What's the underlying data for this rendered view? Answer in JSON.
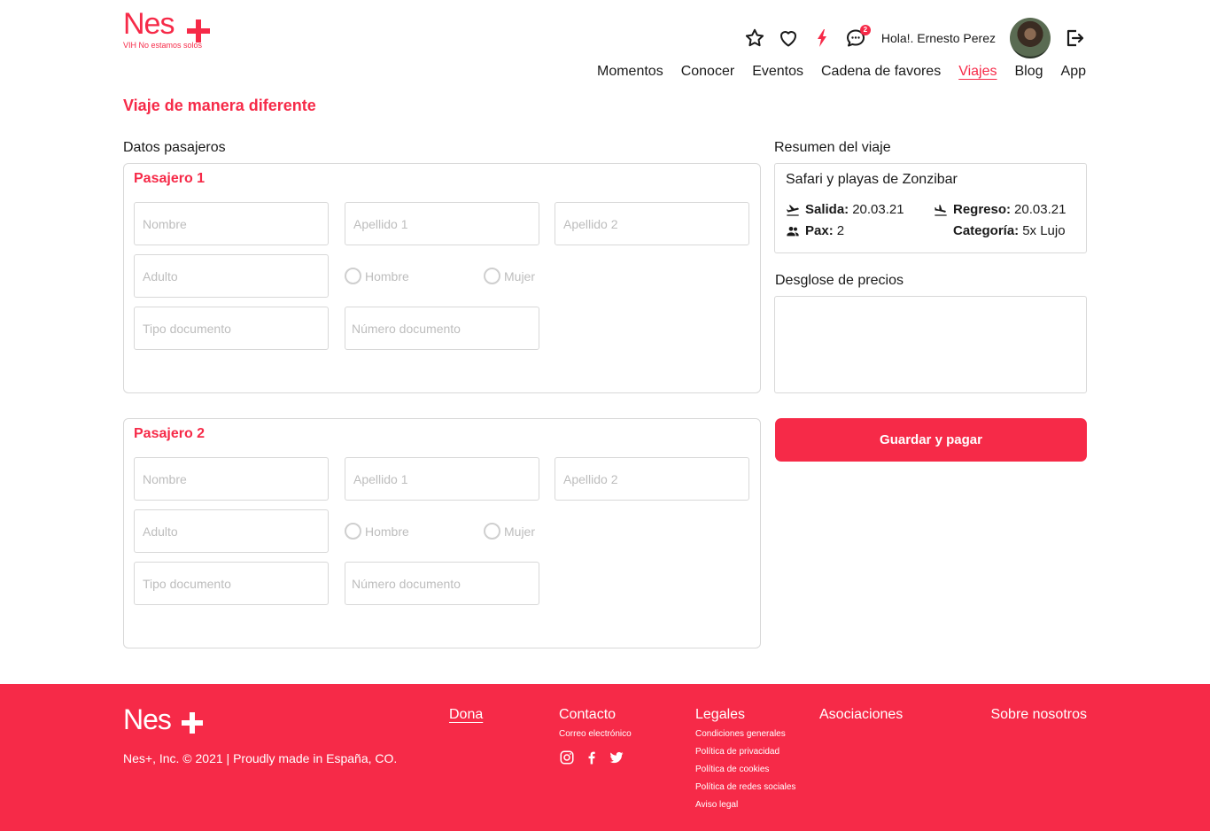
{
  "brand": {
    "name": "Nes",
    "tagline": "VIH No estamos solos",
    "accent": "#f62a48"
  },
  "header": {
    "icons": [
      "star-icon",
      "heart-icon",
      "bolt-icon",
      "chat-icon",
      "logout-icon"
    ],
    "chat_badge": "2",
    "greeting": "Hola!. Ernesto Perez",
    "nav": [
      "Momentos",
      "Conocer",
      "Eventos",
      "Cadena de favores",
      "Viajes",
      "Blog",
      "App"
    ],
    "nav_active": "Viajes"
  },
  "page": {
    "title": "Viaje de manera diferente",
    "passengers_label": "Datos pasajeros",
    "summary_label": "Resumen del viaje",
    "prices_label": "Desglose de precios"
  },
  "passengers": [
    {
      "title": "Pasajero 1",
      "nombre": "Nombre",
      "apellido1": "Apellido 1",
      "apellido2": "Apellido 2",
      "tipo": "Adulto",
      "hombre": "Hombre",
      "mujer": "Mujer",
      "tipo_documento": "Tipo documento",
      "numero_documento": "Número documento"
    },
    {
      "title": "Pasajero 2",
      "nombre": "Nombre",
      "apellido1": "Apellido 1",
      "apellido2": "Apellido 2",
      "tipo": "Adulto",
      "hombre": "Hombre",
      "mujer": "Mujer",
      "tipo_documento": "Tipo documento",
      "numero_documento": "Número documento"
    }
  ],
  "summary": {
    "trip": "Safari y playas de Zonzibar",
    "salida_label": "Salida:",
    "salida": "20.03.21",
    "regreso_label": "Regreso:",
    "regreso": "20.03.21",
    "pax_label": "Pax:",
    "pax": "2",
    "categoria_label": "Categoría:",
    "categoria": "5x Lujo"
  },
  "pay_button": "Guardar y pagar",
  "footer": {
    "logo": "Nes",
    "copyright": "Nes+, Inc. © 2021 | Proudly made in España, CO.",
    "dona": "Dona",
    "contacto": "Contacto",
    "correo": "Correo electrónico",
    "legales": "Legales",
    "legales_links": [
      "Condiciones generales",
      "Política de privacidad",
      "Política de cookies",
      "Política de redes sociales",
      "Aviso legal"
    ],
    "asociaciones": "Asociaciones",
    "sobre": "Sobre nosotros",
    "social": [
      "instagram-icon",
      "facebook-icon",
      "twitter-icon"
    ]
  }
}
